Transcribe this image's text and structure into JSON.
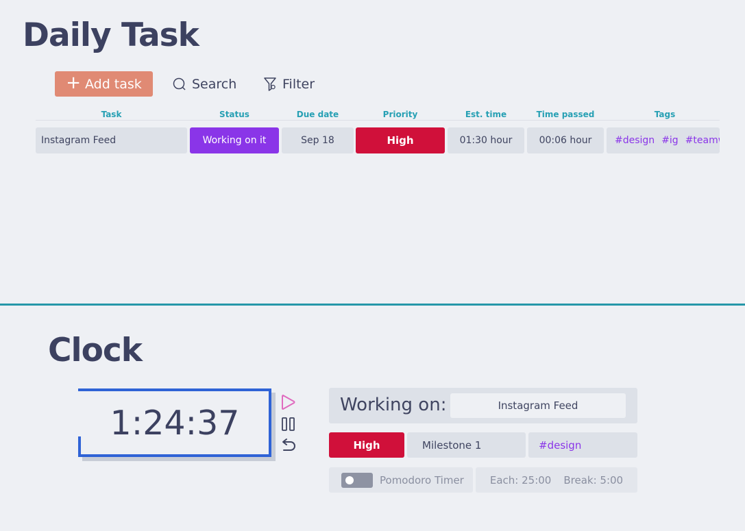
{
  "daily_task": {
    "title": "Daily Task",
    "toolbar": {
      "add_label": "Add task",
      "search_label": "Search",
      "filter_label": "Filter"
    },
    "columns": [
      "Task",
      "Status",
      "Due date",
      "Priority",
      "Est. time",
      "Time passed",
      "Tags"
    ],
    "rows": [
      {
        "task": "Instagram Feed",
        "status": "Working on it",
        "due": "Sep 18",
        "priority": "High",
        "est_time": "01:30 hour",
        "time_passed": "00:06 hour",
        "tags": [
          "#design",
          "#ig",
          "#teamwc"
        ]
      }
    ]
  },
  "clock": {
    "title": "Clock",
    "time": "1:24:37",
    "working_on_label": "Working on:",
    "working_on_value": "Instagram Feed",
    "priority": "High",
    "milestone": "Milestone 1",
    "tag": "#design",
    "pomodoro_label": "Pomodoro Timer",
    "each_label": "Each: 25:00",
    "break_label": "Break: 5:00"
  },
  "colors": {
    "accent_add": "#e08a74",
    "status_purple": "#8a35e8",
    "priority_red": "#d0103a",
    "header_teal": "#27a0b4",
    "clock_blue": "#2f63d6",
    "play_pink": "#e06bbf"
  }
}
